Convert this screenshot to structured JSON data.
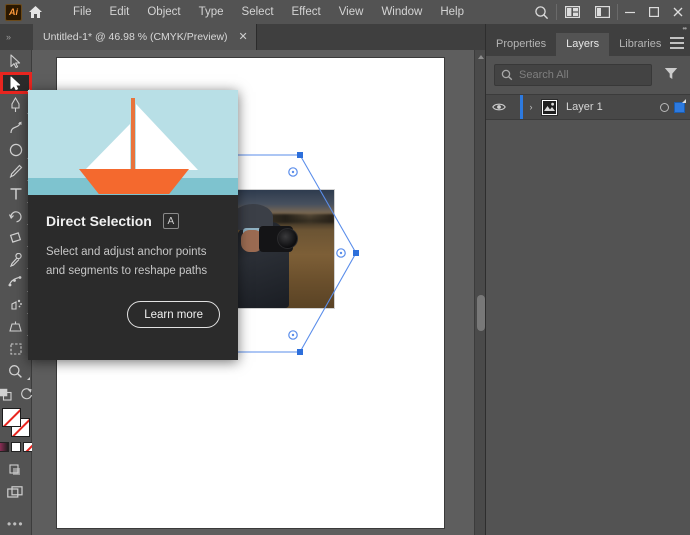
{
  "app": {
    "name": "Adobe Illustrator",
    "logo_text": "Ai",
    "home_icon": "home-icon"
  },
  "menubar": {
    "items": [
      {
        "label": "File"
      },
      {
        "label": "Edit"
      },
      {
        "label": "Object"
      },
      {
        "label": "Type"
      },
      {
        "label": "Select"
      },
      {
        "label": "Effect"
      },
      {
        "label": "View"
      },
      {
        "label": "Window"
      },
      {
        "label": "Help"
      }
    ],
    "right_icons": [
      {
        "name": "search-icon"
      },
      {
        "name": "arrange-documents-icon"
      },
      {
        "name": "workspace-switcher-icon"
      }
    ],
    "window_controls": [
      {
        "name": "minimize-button",
        "glyph": "–"
      },
      {
        "name": "maximize-button",
        "glyph": "□"
      },
      {
        "name": "close-button",
        "glyph": "✕"
      }
    ]
  },
  "document_tab": {
    "label": "Untitled-1* @ 46.98 % (CMYK/Preview)",
    "close_glyph": "✕",
    "grip_glyph": "»"
  },
  "toolbar": {
    "tools": [
      {
        "name": "selection-tool",
        "label": "Selection",
        "has_flyout": false,
        "selected": false
      },
      {
        "name": "direct-selection-tool",
        "label": "Direct Selection",
        "has_flyout": true,
        "selected": true
      },
      {
        "name": "pen-tool",
        "label": "Pen",
        "has_flyout": true,
        "selected": false
      },
      {
        "name": "curvature-tool",
        "label": "Curvature",
        "has_flyout": false,
        "selected": false
      },
      {
        "name": "shape-tool",
        "label": "Rectangle",
        "has_flyout": true,
        "selected": false
      },
      {
        "name": "paintbrush-tool",
        "label": "Paintbrush",
        "has_flyout": true,
        "selected": false
      },
      {
        "name": "type-tool",
        "label": "Type",
        "has_flyout": true,
        "selected": false
      },
      {
        "name": "rotate-tool",
        "label": "Rotate",
        "has_flyout": true,
        "selected": false
      },
      {
        "name": "gradient-tool",
        "label": "Gradient",
        "has_flyout": true,
        "selected": false
      },
      {
        "name": "eyedropper-tool",
        "label": "Eyedropper",
        "has_flyout": true,
        "selected": false
      },
      {
        "name": "blend-tool",
        "label": "Blend",
        "has_flyout": true,
        "selected": false
      },
      {
        "name": "symbol-sprayer-tool",
        "label": "Symbol Sprayer",
        "has_flyout": true,
        "selected": false
      },
      {
        "name": "perspective-grid-tool",
        "label": "Perspective Grid",
        "has_flyout": true,
        "selected": false
      },
      {
        "name": "artboard-tool",
        "label": "Artboard",
        "has_flyout": false,
        "selected": false
      },
      {
        "name": "zoom-tool",
        "label": "Zoom",
        "has_flyout": true,
        "selected": false
      }
    ],
    "bottom": {
      "fill_swatch": "none",
      "stroke_swatch": "none",
      "color_mode_gradient": "gradient-swatch",
      "color_mode_solid": "solid-color-swatch",
      "color_mode_none": "none-swatch",
      "draw_mode_icon": "draw-normal-icon",
      "screen_mode_icon": "screen-mode-icon",
      "edit_toolbar_glyph": "•••"
    }
  },
  "canvas": {
    "artboard_label": "artboard",
    "selection": {
      "shape": "hexagon",
      "anchor_color": "#2d7ae0",
      "path_color": "#4a86e8",
      "anchors": 6,
      "midpoint_handles": 3
    },
    "placed_image": {
      "name": "photographer-photo",
      "description": "Photographer holding a camera in a field at dusk"
    },
    "scrollbar": {
      "name": "vertical-scrollbar"
    }
  },
  "right_panel": {
    "tabs": [
      {
        "label": "Properties",
        "active": false
      },
      {
        "label": "Layers",
        "active": true
      },
      {
        "label": "Libraries",
        "active": false
      }
    ],
    "menu_icon": "panel-menu-icon",
    "search": {
      "placeholder": "Search All",
      "value": "",
      "icon": "search-icon",
      "filter_icon": "filter-icon"
    },
    "layers": [
      {
        "name": "Layer 1",
        "visible": true,
        "color": "#2d7ae0",
        "expand_glyph": "›",
        "eye_icon": "eye-icon",
        "thumbnail": "layer-thumbnail",
        "target_icon": "target-circle-icon",
        "selected": true
      }
    ]
  },
  "tooltip": {
    "title": "Direct Selection",
    "shortcut": "A",
    "description": "Select and adjust anchor points and segments to reshape paths",
    "button_label": "Learn more",
    "image": {
      "name": "sailboat-illustration",
      "sky_color": "#b8dfe6",
      "water_color": "#7ec3cf",
      "sail_color": "#ffffff",
      "hull_color": "#f4692e",
      "mast_color": "#e8743c"
    }
  },
  "highlight": {
    "name": "red-highlight-box",
    "color": "#e8251f",
    "target": "direct-selection-tool"
  }
}
